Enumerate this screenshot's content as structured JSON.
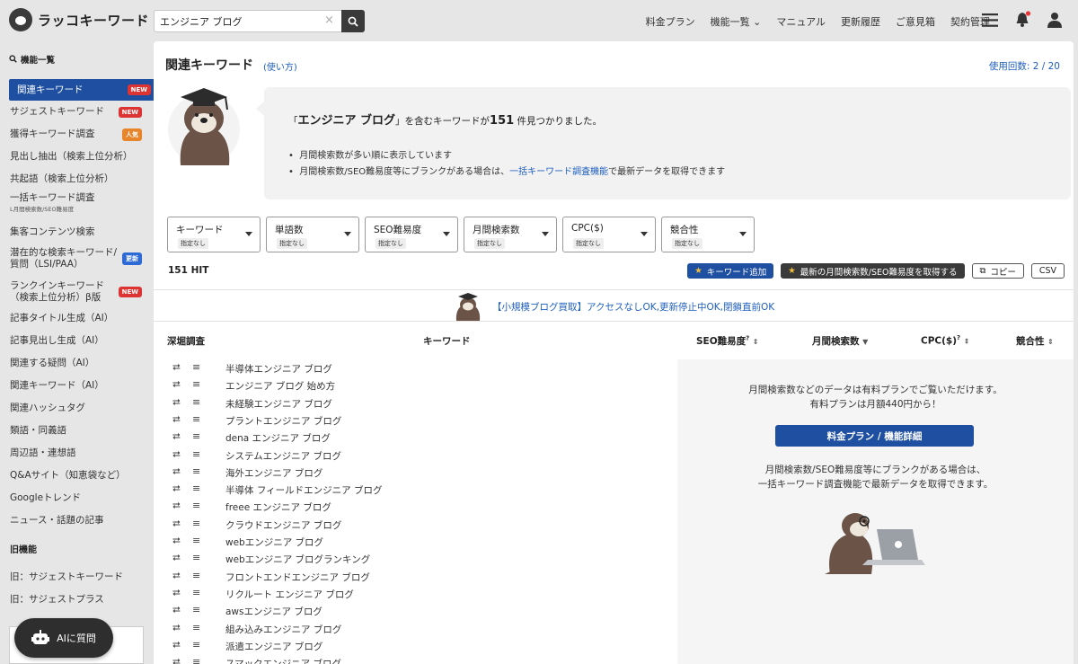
{
  "header": {
    "logo_text": "ラッコキーワード",
    "search_value": "エンジニア ブログ",
    "nav": [
      "料金プラン",
      "機能一覧",
      "マニュアル",
      "更新履歴",
      "ご意見箱",
      "契約管理"
    ],
    "nav_dropdown_caret": "⌄"
  },
  "sidebar": {
    "heading": "機能一覧",
    "items": [
      {
        "label": "関連キーワード",
        "badge": "NEW"
      },
      {
        "label": "サジェストキーワード",
        "badge": "NEW"
      },
      {
        "label": "獲得キーワード調査",
        "badge": "人気"
      },
      {
        "label": "見出し抽出（検索上位分析）"
      },
      {
        "label": "共起語（検索上位分析）"
      },
      {
        "label": "一括キーワード調査",
        "sub": "L月間検索数/SEO難易度"
      },
      {
        "label": "集客コンテンツ検索"
      },
      {
        "label": "潜在的な検索キーワード/",
        "label2": "質問（LSI/PAA）",
        "badge": "更新"
      },
      {
        "label": "ランクインキーワード",
        "label2": "（検索上位分析）β版",
        "badge": "NEW"
      },
      {
        "label": "記事タイトル生成（AI）"
      },
      {
        "label": "記事見出し生成（AI）"
      },
      {
        "label": "関連する疑問（AI）"
      },
      {
        "label": "関連キーワード（AI）"
      },
      {
        "label": "関連ハッシュタグ"
      },
      {
        "label": "類語・同義語"
      },
      {
        "label": "周辺語・連想語"
      },
      {
        "label": "Q&Aサイト（知恵袋など）"
      },
      {
        "label": "Googleトレンド"
      },
      {
        "label": "ニュース・話題の記事"
      }
    ],
    "old_heading": "旧機能",
    "old_items": [
      "旧：サジェストキーワード",
      "旧：サジェストプラス"
    ],
    "ai_button": "AIに質問"
  },
  "main": {
    "title": "関連キーワード",
    "howto": "(使い方)",
    "usage": "使用回数: 2 / 20",
    "info": {
      "quote_open": "「",
      "query": "エンジニア ブログ",
      "quote_mid": "」を含むキーワードが",
      "count": "151",
      "quote_end": " 件見つかりました。",
      "bullet1": "月間検索数が多い順に表示しています",
      "bullet2_pre": "月間検索数/SEO難易度等にブランクがある場合は、",
      "bullet2_link": "一括キーワード調査機能",
      "bullet2_post": "で最新データを取得できます"
    },
    "filters": [
      {
        "label": "キーワード",
        "state": "指定なし"
      },
      {
        "label": "単語数",
        "state": "指定なし"
      },
      {
        "label": "SEO難易度",
        "state": "指定なし"
      },
      {
        "label": "月間検索数",
        "state": "指定なし"
      },
      {
        "label": "CPC($)",
        "state": "指定なし"
      },
      {
        "label": "競合性",
        "state": "指定なし"
      }
    ],
    "hit": "151 HIT",
    "actions": {
      "add_keyword": "キーワード追加",
      "fetch_latest": "最新の月間検索数/SEO難易度を取得する",
      "copy": "コピー",
      "csv": "CSV"
    },
    "promo": "【小規模ブログ買取】アクセスなしOK,更新停止中OK,閉鎖直前OK",
    "columns": {
      "deep": "深堀調査",
      "keyword": "キーワード",
      "seo": "SEO難易度",
      "volume": "月間検索数",
      "cpc": "CPC($)",
      "comp": "競合性",
      "sort_glyph": "⇕",
      "help_glyph": "?",
      "desc_glyph": "▼"
    },
    "keywords": [
      "半導体エンジニア ブログ",
      "エンジニア ブログ 始め方",
      "未経験エンジニア ブログ",
      "プラントエンジニア ブログ",
      "dena エンジニア ブログ",
      "システムエンジニア ブログ",
      "海外エンジニア ブログ",
      "半導体 フィールドエンジニア ブログ",
      "freee エンジニア ブログ",
      "クラウドエンジニア ブログ",
      "webエンジニア ブログ",
      "webエンジニア ブログランキング",
      "フロントエンドエンジニア ブログ",
      "リクルート エンジニア ブログ",
      "awsエンジニア ブログ",
      "組み込みエンジニア ブログ",
      "派遣エンジニア ブログ",
      "スマックエンジニア ブログ"
    ],
    "row_icons": {
      "deep": "⮂",
      "menu": "≡"
    },
    "paid": {
      "line1": "月間検索数などのデータは有料プランでご覧いただけます。",
      "line2": "有料プランは月額440円から！",
      "button": "料金プラン / 機能詳細",
      "line3": "月間検索数/SEO難易度等にブランクがある場合は、",
      "line4": "一括キーワード調査機能で最新データを取得できます。"
    }
  },
  "colors": {
    "accent": "#1e4fa0",
    "link": "#1f5fbf",
    "new_badge": "#dd3333",
    "popular_badge": "#e8852a"
  }
}
